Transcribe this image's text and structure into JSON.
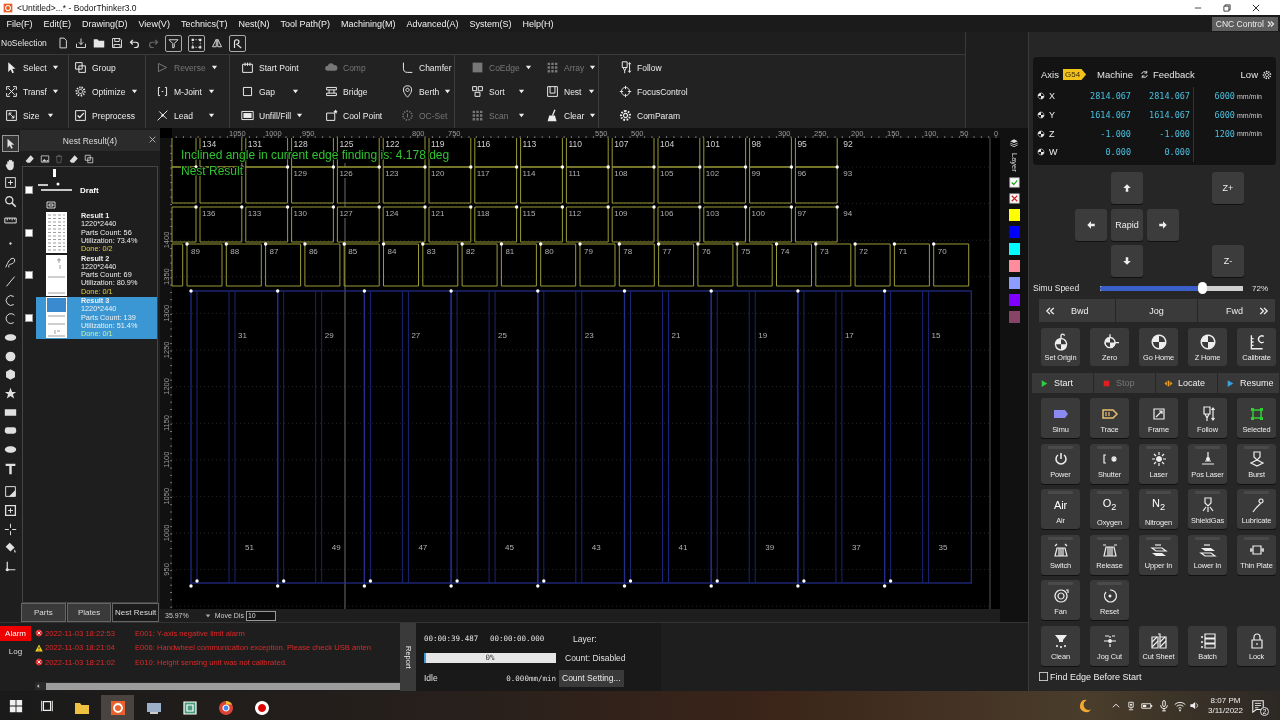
{
  "window": {
    "title": "<Untitled>...* - BodorThinker3.0"
  },
  "menu": [
    "File(F)",
    "Edit(E)",
    "Drawing(D)",
    "View(V)",
    "Technics(T)",
    "Nest(N)",
    "Tool Path(P)",
    "Machining(M)",
    "Advanced(A)",
    "System(S)",
    "Help(H)"
  ],
  "cnc_control": {
    "label": "CNC Control"
  },
  "quick_toolbar": {
    "selection": "NoSelection",
    "tools": [
      {
        "on": false,
        "disabled": false
      },
      {
        "on": false,
        "disabled": false
      },
      {
        "on": false,
        "disabled": false
      },
      {
        "on": false,
        "disabled": false
      },
      {
        "on": false,
        "disabled": false
      },
      {
        "on": false,
        "disabled": true
      },
      {
        "on": true,
        "disabled": false
      },
      {
        "on": true,
        "disabled": false
      },
      {
        "on": false,
        "disabled": false
      },
      {
        "on": true,
        "disabled": false
      }
    ]
  },
  "tool_groups": [
    {
      "columns": [
        [
          {
            "label": "Select",
            "dropdown": true,
            "disabled": false
          },
          {
            "label": "Transf",
            "dropdown": true,
            "disabled": false
          },
          {
            "label": "Size",
            "dropdown": true,
            "disabled": false
          }
        ]
      ]
    },
    {
      "columns": [
        [
          {
            "label": "Group",
            "dropdown": false,
            "disabled": false
          },
          {
            "label": "Optimize",
            "dropdown": true,
            "disabled": false
          },
          {
            "label": "Preprocess",
            "dropdown": false,
            "disabled": false
          }
        ]
      ]
    },
    {
      "columns": [
        [
          {
            "label": "Reverse",
            "dropdown": true,
            "disabled": true
          },
          {
            "label": "M-Joint",
            "dropdown": true,
            "disabled": false
          },
          {
            "label": "Lead",
            "dropdown": true,
            "disabled": false
          }
        ]
      ]
    },
    {
      "columns": [
        [
          {
            "label": "Start Point",
            "dropdown": false,
            "disabled": false
          },
          {
            "label": "Gap",
            "dropdown": true,
            "disabled": false
          },
          {
            "label": "Unfill/Fill",
            "dropdown": true,
            "disabled": false
          }
        ],
        [
          {
            "label": "Comp",
            "dropdown": false,
            "disabled": true
          },
          {
            "label": "Bridge",
            "dropdown": false,
            "disabled": false
          },
          {
            "label": "Cool Point",
            "dropdown": false,
            "disabled": false
          }
        ],
        [
          {
            "label": "Chamfer",
            "dropdown": false,
            "disabled": false
          },
          {
            "label": "Berth",
            "dropdown": true,
            "disabled": false
          },
          {
            "label": "OC-Set",
            "dropdown": false,
            "disabled": true
          }
        ]
      ]
    },
    {
      "columns": [
        [
          {
            "label": "CoEdge",
            "dropdown": true,
            "disabled": true
          },
          {
            "label": "Sort",
            "dropdown": true,
            "disabled": false
          },
          {
            "label": "Scan",
            "dropdown": true,
            "disabled": true
          }
        ],
        [
          {
            "label": "Array",
            "dropdown": true,
            "disabled": true
          },
          {
            "label": "Nest",
            "dropdown": true,
            "disabled": false
          },
          {
            "label": "Clear",
            "dropdown": true,
            "disabled": false
          }
        ]
      ]
    },
    {
      "columns": [
        [
          {
            "label": "Follow",
            "dropdown": false,
            "disabled": false
          },
          {
            "label": "FocusControl",
            "dropdown": false,
            "disabled": false
          },
          {
            "label": "ComParam",
            "dropdown": false,
            "disabled": false
          }
        ]
      ]
    }
  ],
  "tool_strip": [
    {
      "selected": true
    },
    {
      "selected": false
    },
    {
      "selected": false
    },
    {
      "selected": false
    },
    {
      "selected": false
    },
    {
      "selected": false
    },
    {
      "selected": false
    },
    {
      "selected": false
    },
    {
      "selected": false
    },
    {
      "selected": false
    },
    {
      "selected": false
    },
    {
      "selected": false
    },
    {
      "selected": false
    },
    {
      "selected": false
    },
    {
      "selected": false
    },
    {
      "selected": false
    },
    {
      "selected": false
    },
    {
      "selected": false
    },
    {
      "selected": false
    },
    {
      "selected": false
    },
    {
      "selected": false
    },
    {
      "selected": false
    },
    {
      "selected": false
    }
  ],
  "nest_panel": {
    "title": "Nest Result(4)",
    "tools": [
      {
        "disabled": false
      },
      {
        "disabled": false
      },
      {
        "disabled": true
      },
      {
        "disabled": false
      },
      {
        "disabled": false
      }
    ],
    "draft": {
      "label": "Draft",
      "checked": false
    },
    "results": [
      {
        "name": "Result 1",
        "size": "1220*2440",
        "parts": "Parts Count: 56",
        "utilization": "Utilization: 73.4%",
        "done": "Done: 0/2",
        "checked": false,
        "selected": false
      },
      {
        "name": "Result 2",
        "size": "1220*2440",
        "parts": "Parts Count: 69",
        "utilization": "Utilization: 80.9%",
        "done": "Done: 0/1",
        "checked": false,
        "selected": false
      },
      {
        "name": "Result 3",
        "size": "1220*2440",
        "parts": "Parts Count: 139",
        "utilization": "Utilization: 51.4%",
        "done": "Done: 0/1",
        "checked": false,
        "selected": true
      }
    ],
    "tabs": [
      {
        "label": "Parts",
        "selected": false
      },
      {
        "label": "Plates",
        "selected": false
      },
      {
        "label": "Nest Result",
        "selected": true
      }
    ]
  },
  "canvas": {
    "messages": [
      "Inclined angle in current edge finding is: 4.178 deg",
      "Nest Result"
    ],
    "top_ruler": [
      "1050",
      "1000",
      "950",
      "800",
      "750",
      "550",
      "500",
      "300",
      "250",
      "200",
      "150",
      "100",
      "50",
      "0"
    ],
    "left_ruler": [
      "1400",
      "1350",
      "1300",
      "1250",
      "1200",
      "1150",
      "1100",
      "1050",
      "1000",
      "950"
    ],
    "rows": [
      {
        "labels": [
          "134",
          "131",
          "128",
          "125",
          "122",
          "119",
          "116",
          "113",
          "110",
          "107",
          "104",
          "101",
          "98",
          "95",
          "92"
        ]
      },
      {
        "labels": [
          "129",
          "126",
          "123",
          "120",
          "117",
          "114",
          "111",
          "108",
          "105",
          "102",
          "99",
          "96",
          "93"
        ]
      },
      {
        "labels": [
          "136",
          "133",
          "130",
          "127",
          "124",
          "121",
          "118",
          "115",
          "112",
          "109",
          "106",
          "103",
          "100",
          "97",
          "94"
        ]
      },
      {
        "labels": [
          "89",
          "88",
          "87",
          "86",
          "85",
          "84",
          "83",
          "82",
          "81",
          "80",
          "79",
          "78",
          "77",
          "76",
          "75",
          "74",
          "73",
          "72",
          "71",
          "70"
        ]
      }
    ],
    "strips": [
      {
        "upper": "31",
        "lower": "51"
      },
      {
        "upper": "29",
        "lower": "49"
      },
      {
        "upper": "27",
        "lower": "47"
      },
      {
        "upper": "25",
        "lower": "45"
      },
      {
        "upper": "23",
        "lower": "43"
      },
      {
        "upper": "21",
        "lower": "41"
      },
      {
        "upper": "19",
        "lower": "39"
      },
      {
        "upper": "17",
        "lower": "37"
      },
      {
        "upper": "15",
        "lower": "35"
      }
    ]
  },
  "layers": {
    "label": "Layer",
    "swatches": [
      {
        "color": "#ffff00"
      },
      {
        "color": "#0000ff"
      },
      {
        "color": "#00ffff"
      },
      {
        "color": "#ff8c9c"
      },
      {
        "color": "#8c9cff"
      },
      {
        "color": "#8000ff"
      },
      {
        "color": "#884466"
      }
    ]
  },
  "view_status": {
    "zoom": "35.97%",
    "move_label": "Move Dis",
    "move_value": "10"
  },
  "log_panel": {
    "tabs": [
      {
        "label": "Alarm",
        "selected": true
      },
      {
        "label": "Log",
        "selected": false
      }
    ],
    "entries": [
      {
        "kind": "error",
        "time": "2022-11-03 18:22:53",
        "message": "E001: Y-axis negative limit alarm"
      },
      {
        "kind": "warning",
        "time": "2022-11-03 18:21:04",
        "message": "E006: Handwheel communication exception. Please check USB anten"
      },
      {
        "kind": "error",
        "time": "2022-11-03 18:21:02",
        "message": "E010: Height sensing unit was not calibrated."
      }
    ]
  },
  "report_tab": "Report",
  "status_panel": {
    "elapsed": "00:00:39.487",
    "remaining": "00:00:00.000",
    "progress": {
      "level": 0,
      "reading": "0%"
    },
    "state": "Idle",
    "feed": "0.000mm/min",
    "layer": "Layer:",
    "count": "Count: Disabled",
    "count_button": "Count Setting..."
  },
  "axis_panel": {
    "axis": "Axis",
    "coordinate_system": "G54",
    "machine": "Machine",
    "feedback": "Feedback",
    "speed_mode": "Low",
    "rows": [
      {
        "axis": "X",
        "machine": "2814.067",
        "feedback": "2814.067",
        "speed": "6000",
        "unit": "mm/min"
      },
      {
        "axis": "Y",
        "machine": "1614.067",
        "feedback": "1614.067",
        "speed": "6000",
        "unit": "mm/min"
      },
      {
        "axis": "Z",
        "machine": "-1.000",
        "feedback": "-1.000",
        "speed": "1200",
        "unit": "mm/min"
      },
      {
        "axis": "W",
        "machine": "0.000",
        "feedback": "0.000"
      }
    ]
  },
  "jog_pad": {
    "center": "Rapid",
    "z_up": "Z+",
    "z_down": "Z-"
  },
  "simu_speed": {
    "label": "Simu Speed",
    "level": 0.72,
    "reading": "72%"
  },
  "step_bar": [
    "Bwd",
    "Jog",
    "Fwd"
  ],
  "origin_buttons": [
    "Set Origin",
    "Zero",
    "Go Home",
    "Z Home",
    "Calibrate"
  ],
  "run_bar": [
    {
      "label": "Start",
      "disabled": false
    },
    {
      "label": "Stop",
      "disabled": true
    },
    {
      "label": "Locate",
      "disabled": false
    },
    {
      "label": "Resume",
      "disabled": false
    }
  ],
  "function_rows": [
    [
      {
        "label": "Simu",
        "kind": "action"
      },
      {
        "label": "Trace",
        "kind": "action"
      },
      {
        "label": "Frame",
        "kind": "action"
      },
      {
        "label": "Follow",
        "kind": "action"
      },
      {
        "label": "Selected",
        "kind": "action"
      }
    ],
    [
      {
        "label": "Power",
        "kind": "toggle",
        "on": false
      },
      {
        "label": "Shutter",
        "kind": "toggle",
        "on": false
      },
      {
        "label": "Laser",
        "kind": "toggle",
        "on": false
      },
      {
        "label": "Pos Laser",
        "kind": "toggle",
        "on": false
      },
      {
        "label": "Burst",
        "kind": "toggle",
        "on": false
      }
    ],
    [
      {
        "label": "Air",
        "kind": "toggle",
        "on": false,
        "symbol": "Air"
      },
      {
        "label": "Oxygen",
        "kind": "toggle",
        "on": false,
        "symbol": "O$_{2}$"
      },
      {
        "label": "Nitrogen",
        "kind": "toggle",
        "on": false,
        "symbol": "N$_{2}$"
      },
      {
        "label": "ShieldGas",
        "kind": "toggle",
        "on": false
      },
      {
        "label": "Lubricate",
        "kind": "toggle",
        "on": false
      }
    ],
    [
      {
        "label": "Switch",
        "kind": "toggle",
        "on": false
      },
      {
        "label": "Release",
        "kind": "toggle",
        "on": false
      },
      {
        "label": "Upper In",
        "kind": "toggle",
        "on": false
      },
      {
        "label": "Lower In",
        "kind": "toggle",
        "on": false
      },
      {
        "label": "Thin Plate",
        "kind": "toggle",
        "on": false
      }
    ],
    [
      {
        "label": "Fan",
        "kind": "toggle",
        "on": false
      },
      {
        "label": "Reset",
        "kind": "toggle",
        "on": false
      }
    ],
    [
      {
        "label": "Clean",
        "kind": "action"
      },
      {
        "label": "Jog Cut",
        "kind": "action"
      },
      {
        "label": "Cut Sheet",
        "kind": "action"
      },
      {
        "label": "Batch",
        "kind": "action"
      },
      {
        "label": "Lock",
        "kind": "action"
      }
    ]
  ],
  "find_edge": {
    "label": "Find Edge Before Start",
    "checked": false
  },
  "taskbar": {
    "apps": [
      {
        "running": true,
        "selected": false
      },
      {
        "running": true,
        "selected": true
      },
      {
        "running": true,
        "selected": false
      },
      {
        "running": true,
        "selected": false
      },
      {
        "running": true,
        "selected": false
      },
      {
        "running": true,
        "selected": false
      }
    ],
    "clock": {
      "time": "8:07 PM",
      "date": "3/11/2022"
    },
    "notification_count": "2"
  }
}
